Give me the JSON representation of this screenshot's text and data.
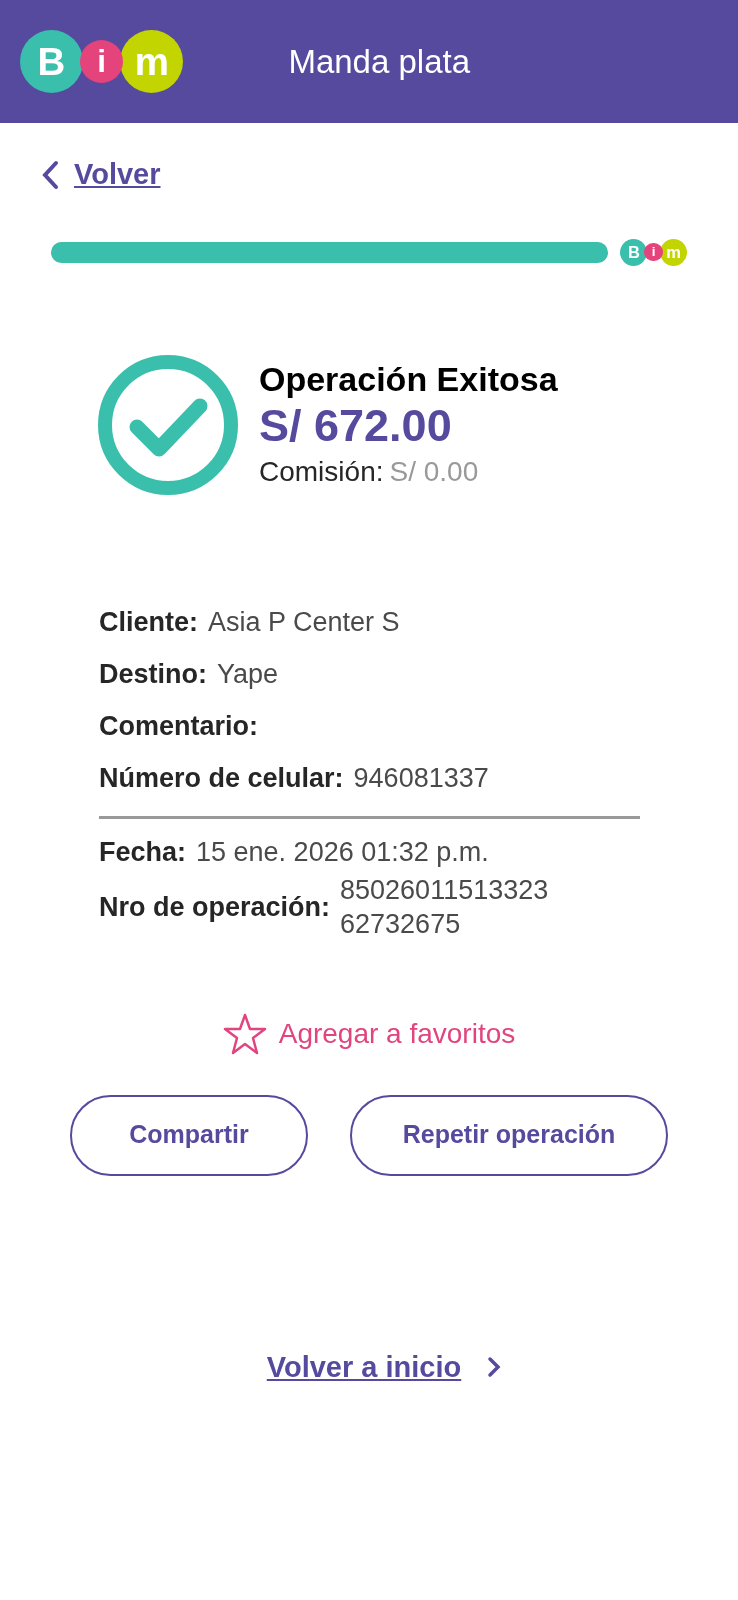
{
  "header": {
    "logo_letters": [
      "B",
      "i",
      "m"
    ],
    "title": "Manda plata"
  },
  "back_link": {
    "label": "Volver"
  },
  "progress": {
    "level": 1,
    "logo_letters": [
      "B",
      "i",
      "m"
    ]
  },
  "result": {
    "title": "Operación Exitosa",
    "amount": "S/ 672.00",
    "fee_label": "Comisión:",
    "fee_value": "S/ 0.00"
  },
  "details": [
    {
      "label": "Cliente:",
      "value": "Asia P Center S"
    },
    {
      "label": "Destino:",
      "value": "Yape"
    },
    {
      "label": "Comentario:"
    },
    {
      "label": "Número de celular:",
      "value": "946081337"
    }
  ],
  "meta": [
    {
      "label": "Fecha:",
      "value": "15 ene. 2026 01:32 p.m."
    },
    {
      "label": "Nro de operación:",
      "value": "8502601151332362732675"
    }
  ],
  "favorite": {
    "label": "Agregar a favoritos",
    "starred": false
  },
  "buttons": [
    "Compartir",
    "Repetir operación"
  ],
  "home_link": {
    "label": "Volver a inicio"
  }
}
